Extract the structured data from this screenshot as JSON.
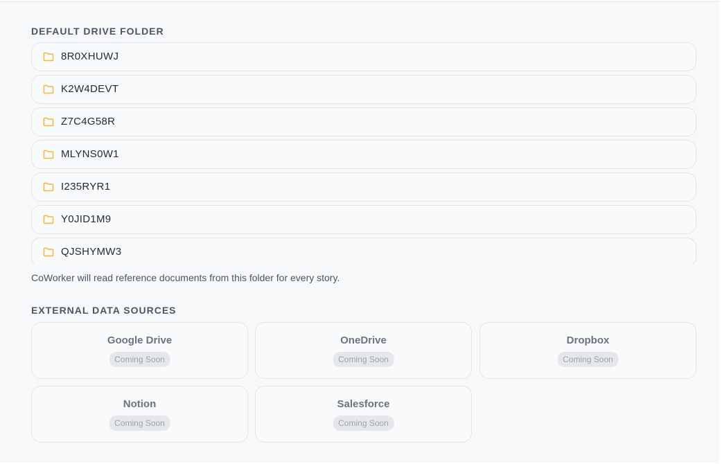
{
  "default_folder": {
    "title": "DEFAULT DRIVE FOLDER",
    "folders": [
      "8R0XHUWJ",
      "K2W4DEVT",
      "Z7C4G58R",
      "MLYNS0W1",
      "I235RYR1",
      "Y0JID1M9",
      "QJSHYMW3"
    ],
    "helper": "CoWorker will read reference documents from this folder for every story."
  },
  "external_sources": {
    "title": "EXTERNAL DATA SOURCES",
    "items": [
      {
        "name": "Google Drive",
        "badge": "Coming Soon"
      },
      {
        "name": "OneDrive",
        "badge": "Coming Soon"
      },
      {
        "name": "Dropbox",
        "badge": "Coming Soon"
      },
      {
        "name": "Notion",
        "badge": "Coming Soon"
      },
      {
        "name": "Salesforce",
        "badge": "Coming Soon"
      }
    ]
  },
  "colors": {
    "folder_icon": "#f5b82e",
    "card_border": "#e3e5e8",
    "badge_bg": "#e5e7eb"
  },
  "icons": {
    "folder": "folder-icon"
  }
}
